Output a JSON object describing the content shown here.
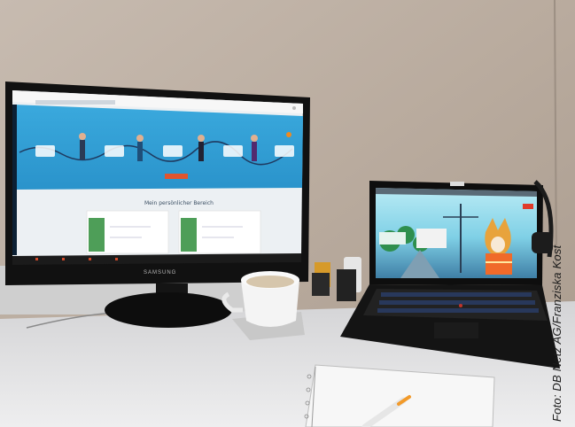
{
  "photo": {
    "credit": "Foto: DB Netz AG/Franziska Kost",
    "monitor_brand": "SAMSUNG",
    "screen_heading": "Mein persönlicher Bereich"
  },
  "colors": {
    "wall": "#b7a99c",
    "desk": "#dcdcdc",
    "screen_blue": "#2f9fd6",
    "accent_orange": "#e0552e"
  }
}
